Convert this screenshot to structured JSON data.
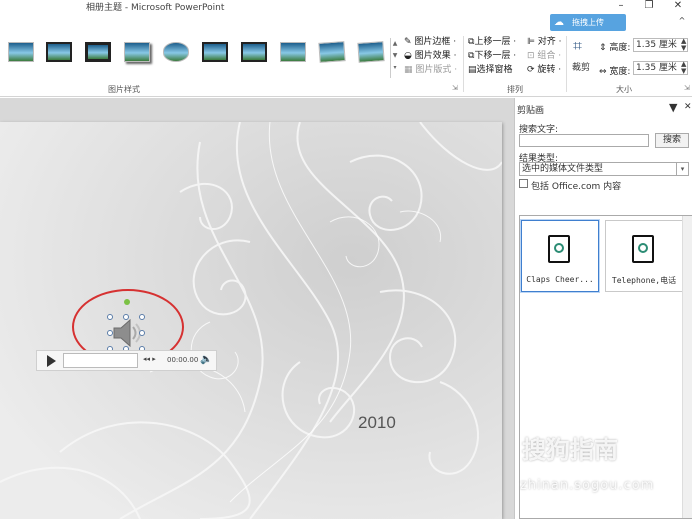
{
  "window": {
    "title": "相册主题 - Microsoft PowerPoint",
    "minimize": "–",
    "restore": "❐",
    "close": "✕",
    "help": "?",
    "collapse": "^"
  },
  "upload_button": {
    "label": "拖拽上传",
    "icon": "cloud-icon"
  },
  "ribbon": {
    "picture_border": "图片边框 ·",
    "picture_effects": "图片效果 ·",
    "picture_layout": "图片版式 ·",
    "picture_styles_group": "图片样式",
    "bring_forward": "上移一层 ·",
    "send_backward": "下移一层 ·",
    "selection_pane": "选择窗格",
    "align": "对齐 ·",
    "group": "组合 ·",
    "rotate": "旋转 ·",
    "arrange_group": "排列",
    "crop": "裁剪",
    "height_label": "高度:",
    "height_value": "1.35 厘米",
    "width_label": "宽度:",
    "width_value": "1.35 厘米",
    "size_group": "大小",
    "dialog_launcher": "⇲"
  },
  "slide": {
    "year_text": "2010",
    "player_time": "00:00.00"
  },
  "clip_art": {
    "pane_title": "剪贴画",
    "search_label": "搜索文字:",
    "search_value": "",
    "search_button": "搜索",
    "results_label": "结果类型:",
    "results_value": "选中的媒体文件类型",
    "include_office": "包括 Office.com 内容",
    "items": [
      {
        "caption": "Claps Cheer..."
      },
      {
        "caption": "Telephone,电话"
      }
    ]
  },
  "watermark": {
    "line1": "搜狗指南",
    "line2": "zhinan.sogou.com"
  }
}
